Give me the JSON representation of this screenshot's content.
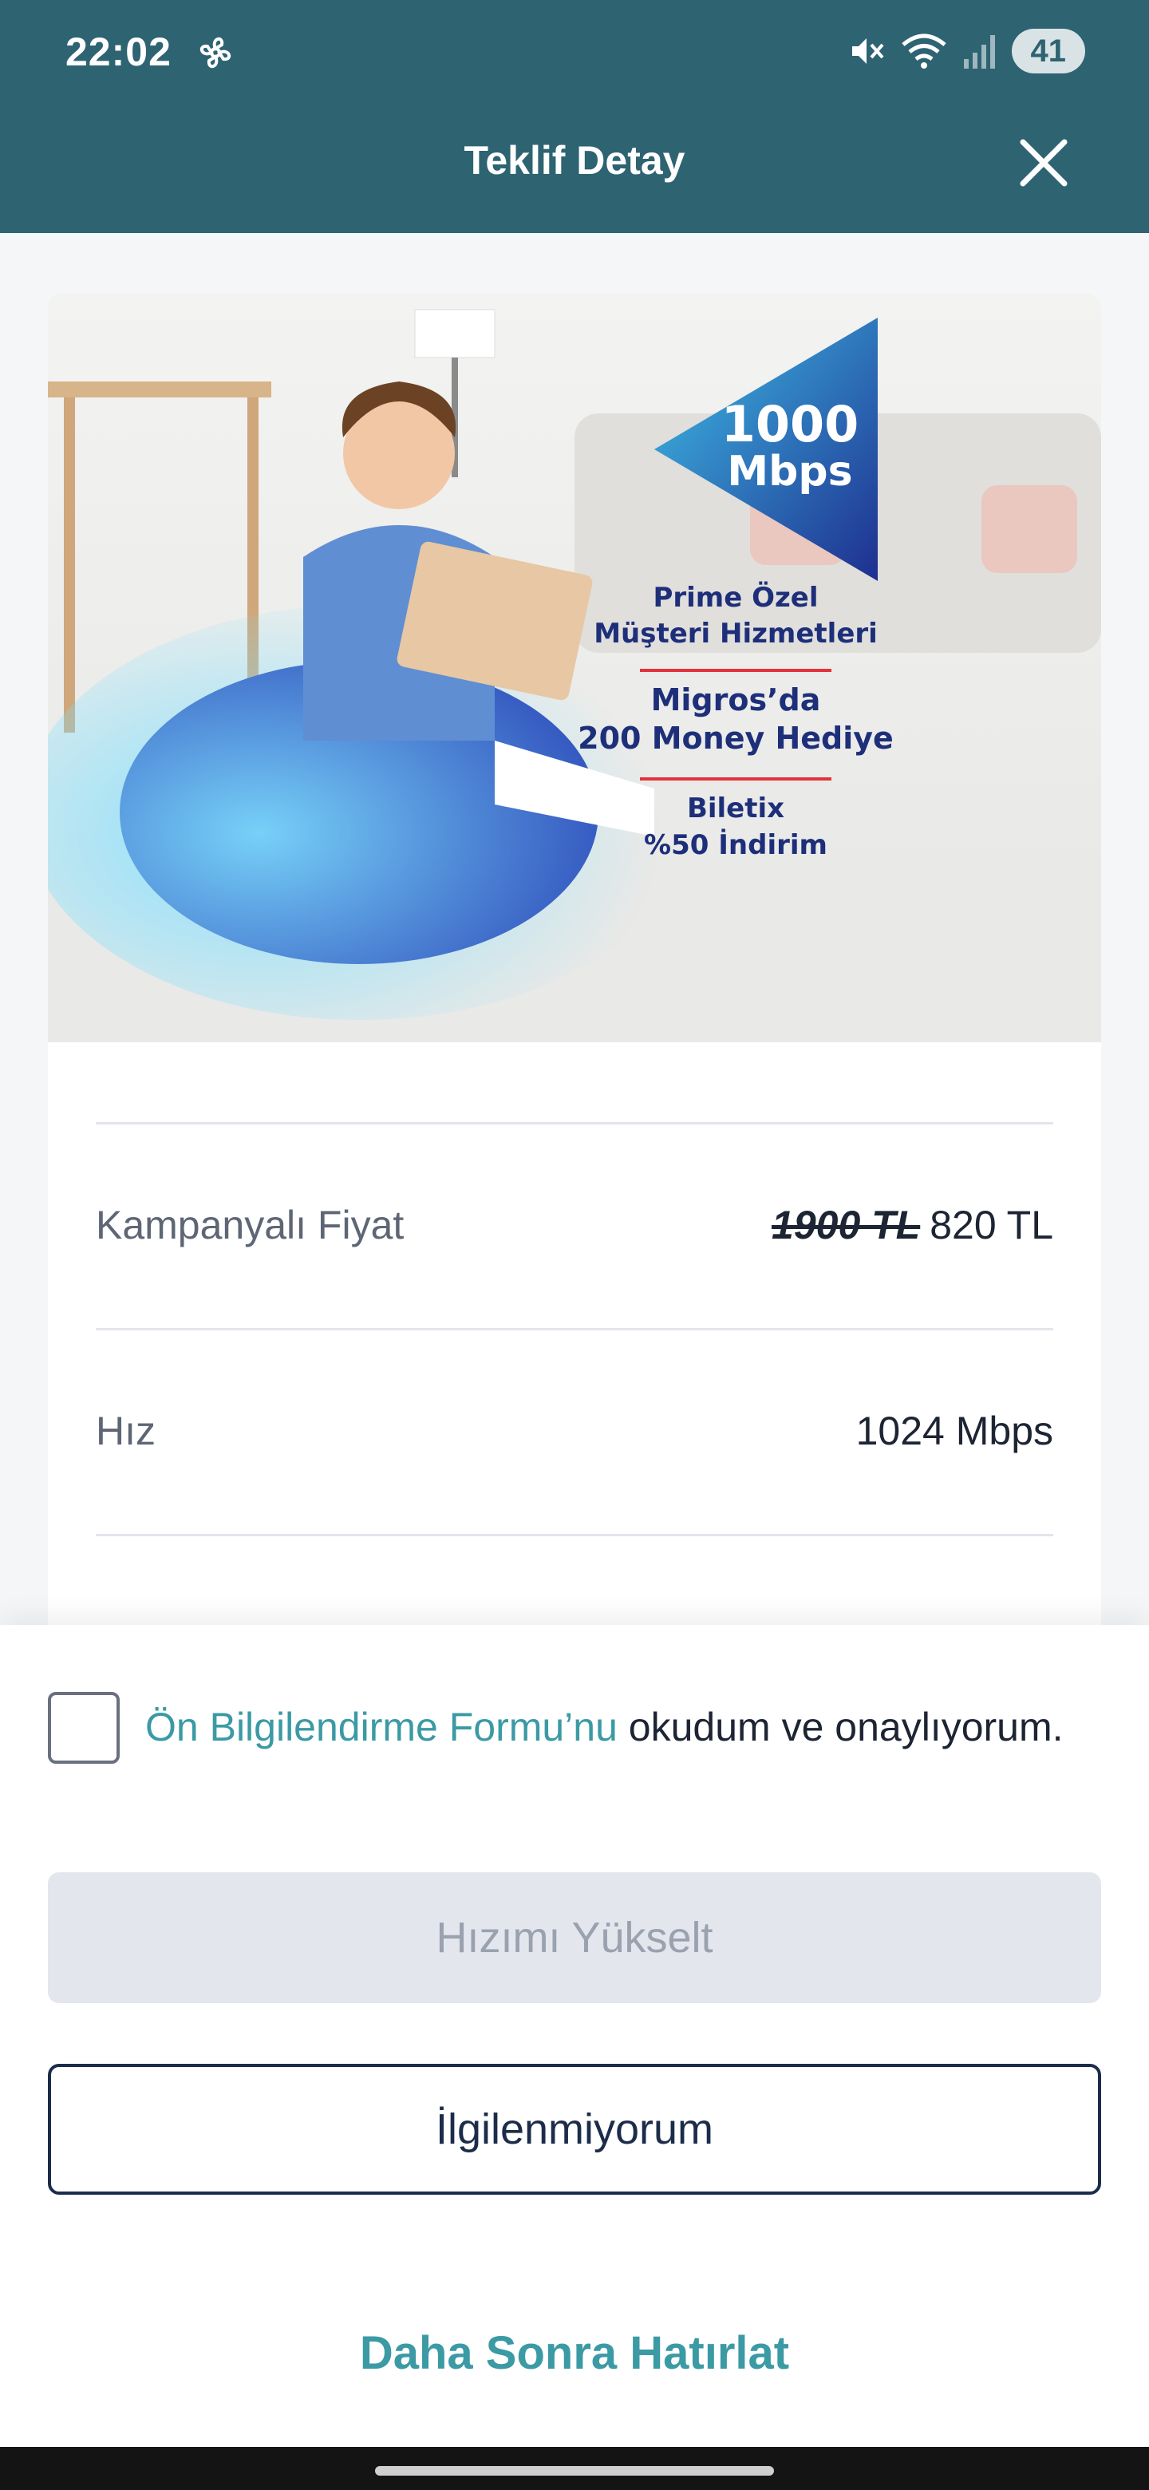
{
  "status_bar": {
    "time": "22:02",
    "battery": "41",
    "icons": [
      "fan-icon",
      "mute-icon",
      "wifi-icon",
      "signal-icon"
    ]
  },
  "header": {
    "title": "Teklif Detay",
    "close_icon": "close-icon",
    "background": "#2e6372"
  },
  "hero": {
    "speed_badge_number": "1000",
    "speed_badge_unit": "Mbps",
    "promo_1_line1": "Prime Özel",
    "promo_1_line2": "Müşteri Hizmetleri",
    "promo_2_line1": "Migros’da",
    "promo_2_line2": "200 Money Hediye",
    "promo_3_line1": "Biletix",
    "promo_3_line2": "%50 İndirim"
  },
  "details": {
    "price_label": "Kampanyalı Fiyat",
    "price_old": "1900 TL",
    "price_new": "820 TL",
    "speed_label": "Hız",
    "speed_value": "1024 Mbps"
  },
  "sheet": {
    "consent_link": "Ön Bilgilendirme Formu’nu",
    "consent_text": " okudum ve onaylıyorum.",
    "checkbox_checked": false,
    "primary_button": "Hızımı Yükselt",
    "secondary_button": "İlgilenmiyorum",
    "text_button": "Daha Sonra Hatırlat"
  },
  "colors": {
    "accent": "#3b9aa4",
    "navy": "#1c2c4a",
    "disabled_bg": "#e3e6ec",
    "divider_red": "#e0343a"
  }
}
